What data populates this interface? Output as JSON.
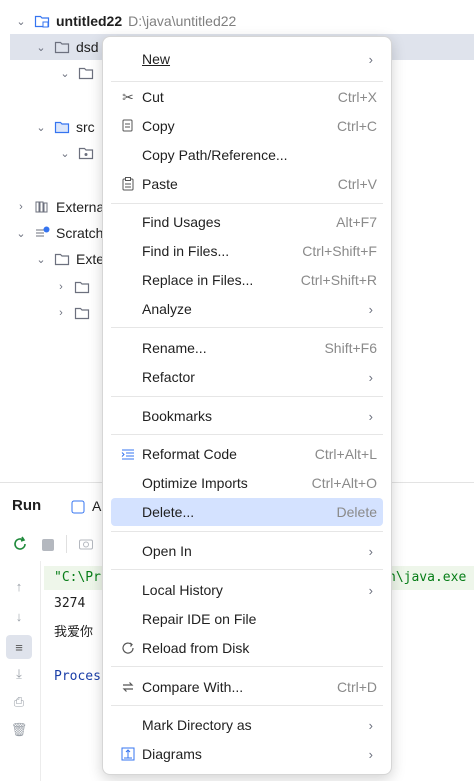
{
  "project": {
    "root_name": "untitled22",
    "root_path": "D:\\java\\untitled22",
    "selected_folder": "dsd",
    "src_label": "src",
    "external_label": "Externa",
    "scratches_label": "Scratch",
    "exte_label": "Exte"
  },
  "run_panel": {
    "title": "Run",
    "tab_label": "A",
    "console_lines": {
      "cmd_start": "\"C:\\Pr",
      "cmd_end": "n\\java.exe",
      "output1": "3274",
      "output2": "我爱你",
      "process": "Proces"
    }
  },
  "menu": {
    "items": [
      {
        "label": "New",
        "shortcut": "",
        "submenu": true,
        "icon": ""
      },
      {
        "label": "Cut",
        "shortcut": "Ctrl+X",
        "submenu": false,
        "icon": "scissors-icon"
      },
      {
        "label": "Copy",
        "shortcut": "Ctrl+C",
        "submenu": false,
        "icon": "copy-icon"
      },
      {
        "label": "Copy Path/Reference...",
        "shortcut": "",
        "submenu": false,
        "icon": ""
      },
      {
        "label": "Paste",
        "shortcut": "Ctrl+V",
        "submenu": false,
        "icon": "paste-icon"
      },
      {
        "label": "Find Usages",
        "shortcut": "Alt+F7",
        "submenu": false,
        "icon": ""
      },
      {
        "label": "Find in Files...",
        "shortcut": "Ctrl+Shift+F",
        "submenu": false,
        "icon": ""
      },
      {
        "label": "Replace in Files...",
        "shortcut": "Ctrl+Shift+R",
        "submenu": false,
        "icon": ""
      },
      {
        "label": "Analyze",
        "shortcut": "",
        "submenu": true,
        "icon": ""
      },
      {
        "label": "Rename...",
        "shortcut": "Shift+F6",
        "submenu": false,
        "icon": ""
      },
      {
        "label": "Refactor",
        "shortcut": "",
        "submenu": true,
        "icon": ""
      },
      {
        "label": "Bookmarks",
        "shortcut": "",
        "submenu": true,
        "icon": ""
      },
      {
        "label": "Reformat Code",
        "shortcut": "Ctrl+Alt+L",
        "submenu": false,
        "icon": "reformat-icon"
      },
      {
        "label": "Optimize Imports",
        "shortcut": "Ctrl+Alt+O",
        "submenu": false,
        "icon": ""
      },
      {
        "label": "Delete...",
        "shortcut": "Delete",
        "submenu": false,
        "icon": ""
      },
      {
        "label": "Open In",
        "shortcut": "",
        "submenu": true,
        "icon": ""
      },
      {
        "label": "Local History",
        "shortcut": "",
        "submenu": true,
        "icon": ""
      },
      {
        "label": "Repair IDE on File",
        "shortcut": "",
        "submenu": false,
        "icon": ""
      },
      {
        "label": "Reload from Disk",
        "shortcut": "",
        "submenu": false,
        "icon": "reload-icon"
      },
      {
        "label": "Compare With...",
        "shortcut": "Ctrl+D",
        "submenu": false,
        "icon": "compare-icon"
      },
      {
        "label": "Mark Directory as",
        "shortcut": "",
        "submenu": true,
        "icon": ""
      },
      {
        "label": "Diagrams",
        "shortcut": "",
        "submenu": true,
        "icon": "diagram-icon"
      }
    ]
  },
  "colors": {
    "selection": "#d4e2ff",
    "tree_selection": "#dfe3ec",
    "folder": "#6c707e",
    "console_text": "#1f1f1f",
    "process_text": "#1a3ea8"
  }
}
